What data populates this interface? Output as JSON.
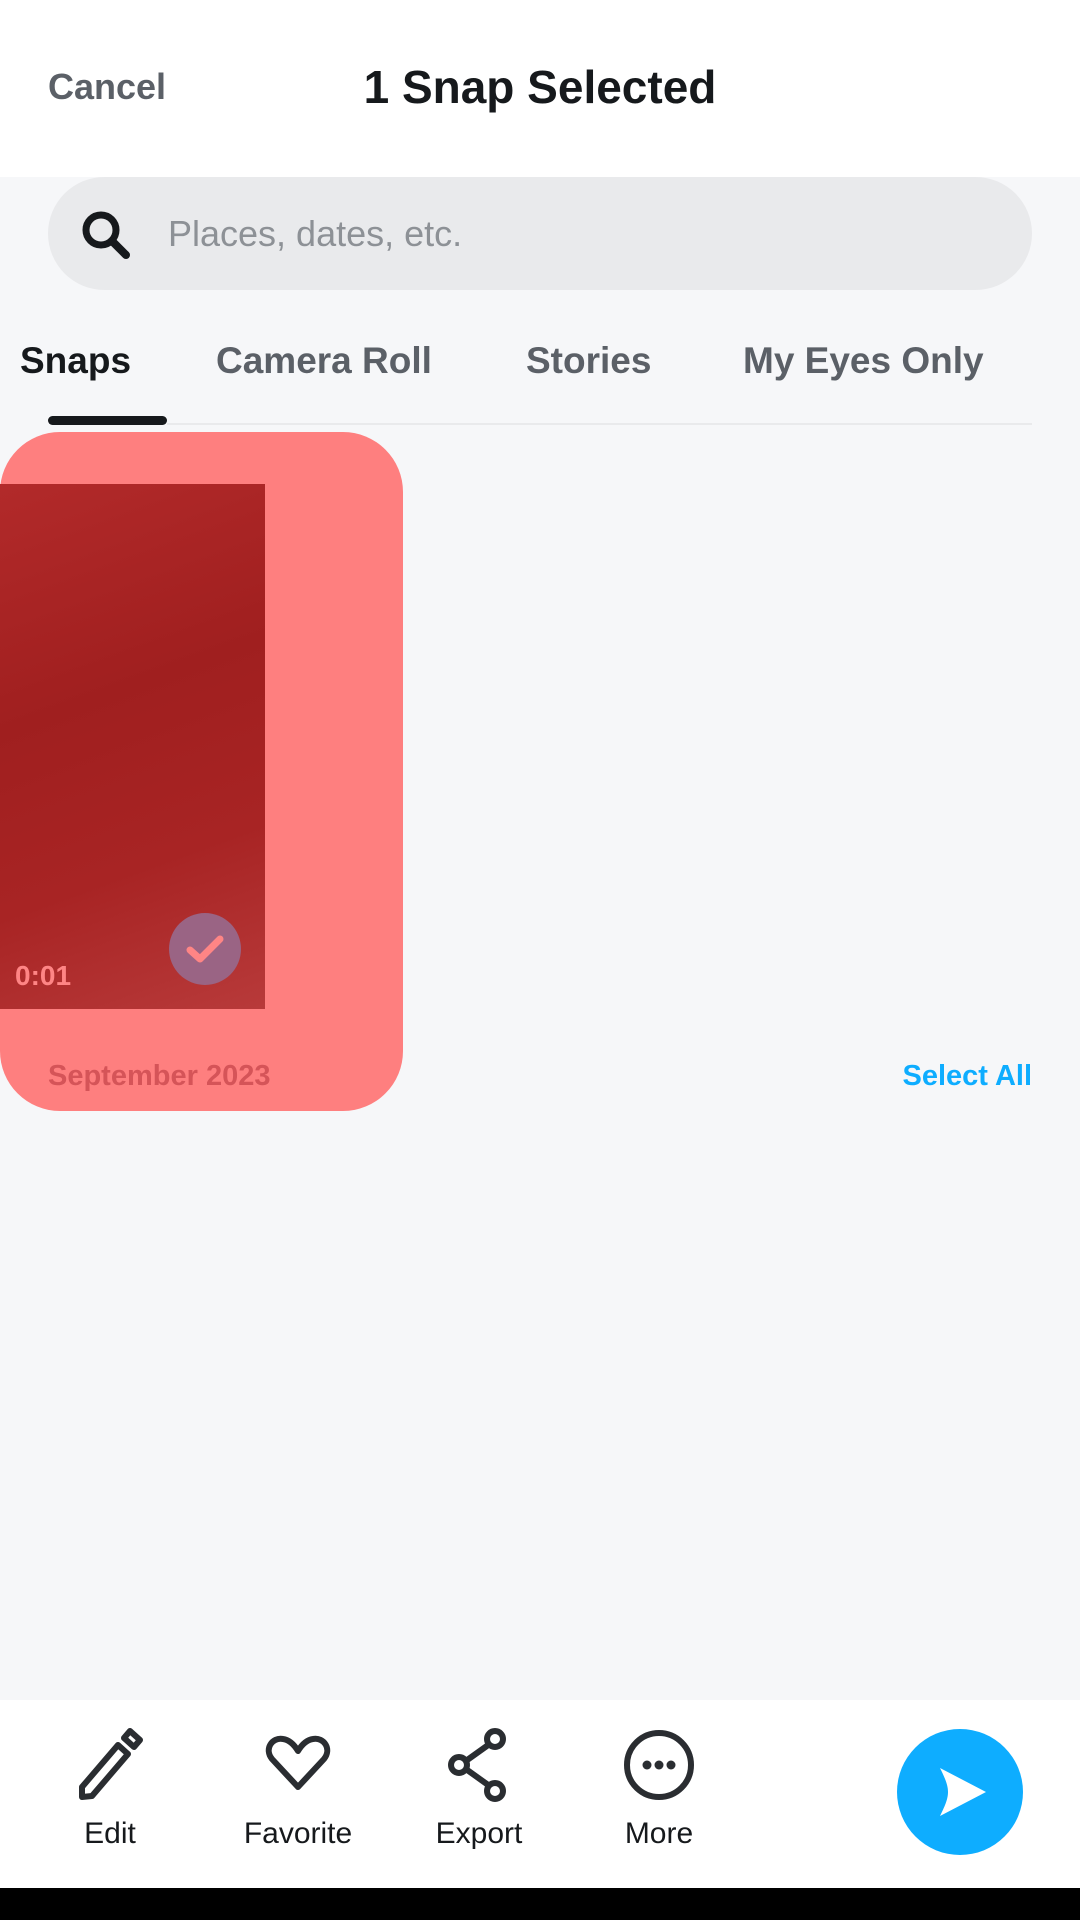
{
  "header": {
    "cancel_label": "Cancel",
    "title": "1 Snap Selected"
  },
  "search": {
    "placeholder": "Places, dates, etc.",
    "value": "",
    "icon": "search-icon"
  },
  "tabs": [
    {
      "label": "Snaps",
      "active": true
    },
    {
      "label": "Camera Roll"
    },
    {
      "label": "Stories"
    },
    {
      "label": "My Eyes Only"
    }
  ],
  "gallery": {
    "items": [
      {
        "duration": "0:01",
        "selected": true
      }
    ],
    "section_label": "September 2023",
    "select_all_label": "Select All"
  },
  "actions": [
    {
      "label": "Edit",
      "icon": "pencil-icon"
    },
    {
      "label": "Favorite",
      "icon": "heart-icon"
    },
    {
      "label": "Export",
      "icon": "share-icon"
    },
    {
      "label": "More",
      "icon": "more-icon"
    }
  ],
  "send_icon": "send-icon",
  "colors": {
    "accent": "#0eadff",
    "highlight": "#fe7f7f"
  }
}
